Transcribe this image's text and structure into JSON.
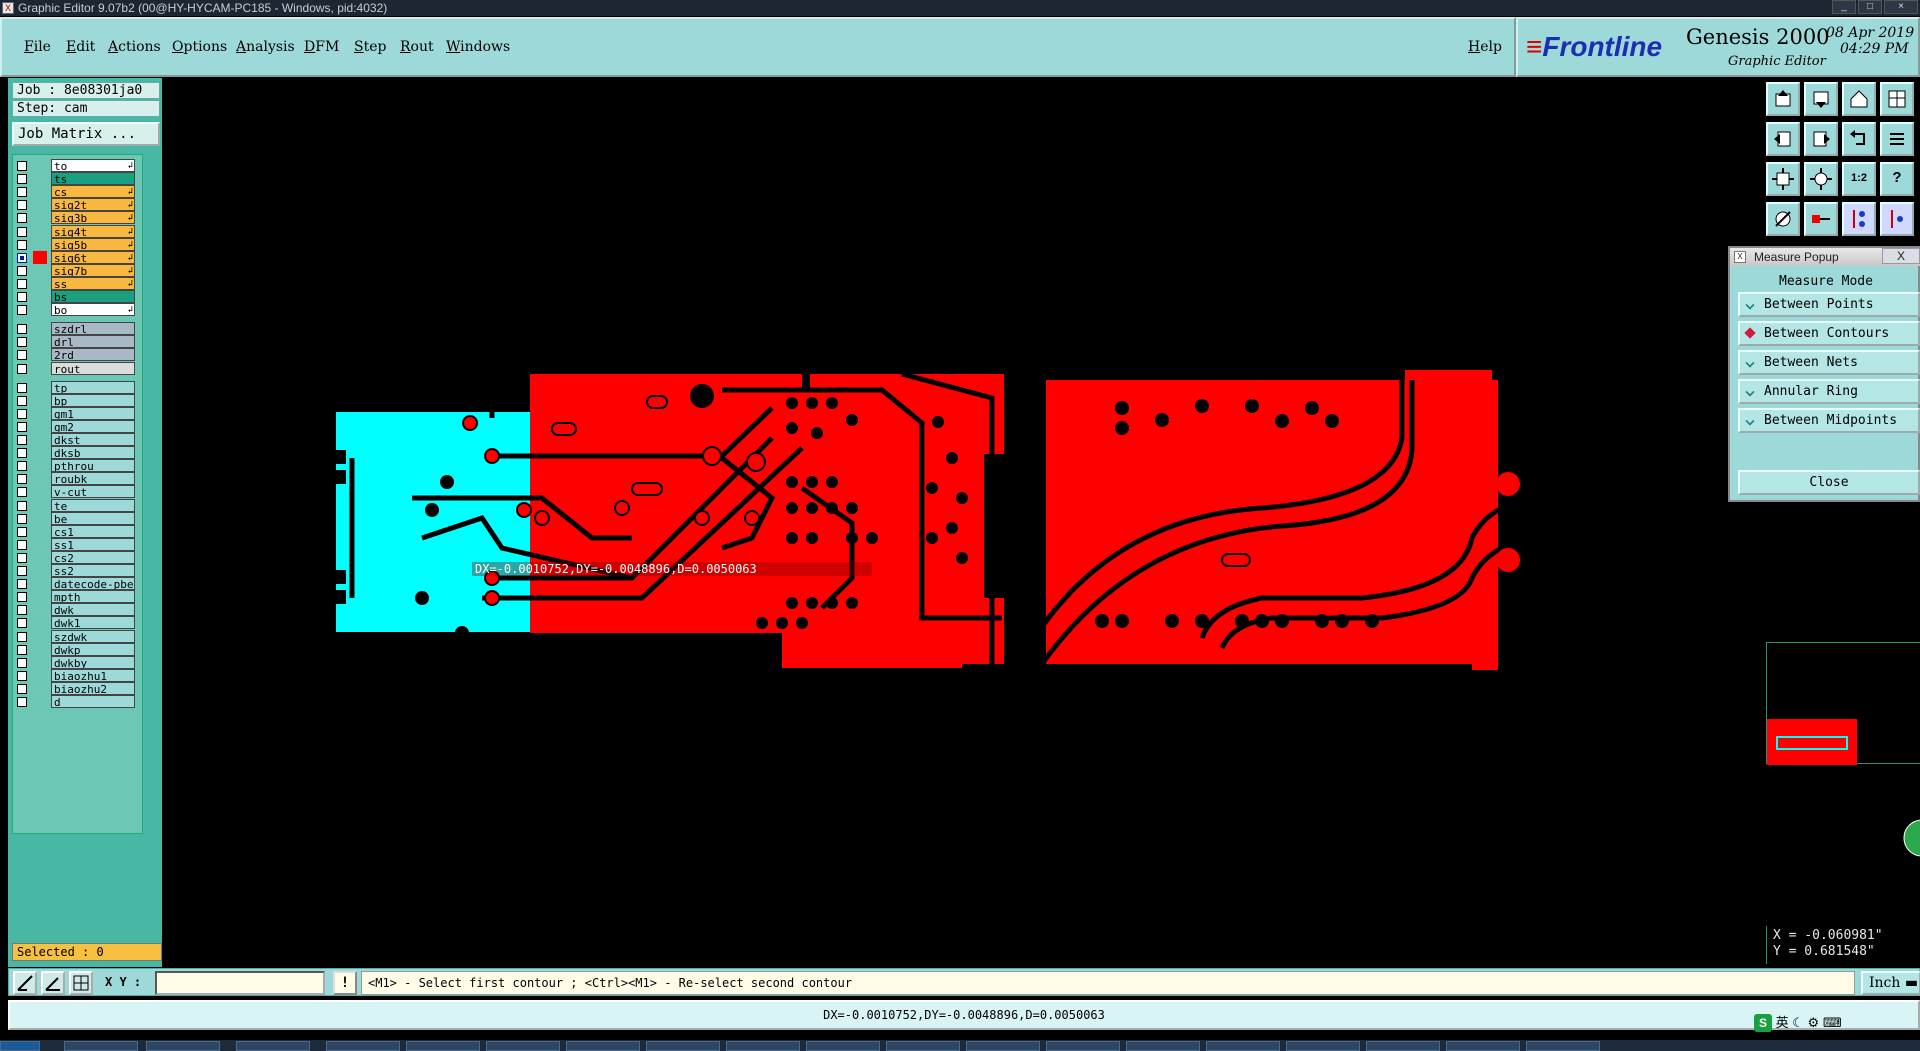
{
  "window": {
    "title": "Graphic Editor 9.07b2 (00@HY-HYCAM-PC185 - Windows, pid:4032)"
  },
  "menu": [
    "File",
    "Edit",
    "Actions",
    "Options",
    "Analysis",
    "DFM",
    "Step",
    "Rout",
    "Windows"
  ],
  "help": "Help",
  "brand": {
    "logo": "Frontline",
    "product": "Genesis 2000",
    "subtitle": "Graphic Editor",
    "date": "08 Apr 2019",
    "time": "04:29 PM"
  },
  "job": {
    "job_label": "Job : 8e08301ja0",
    "step_label": "Step: cam",
    "matrix_button": "Job Matrix ..."
  },
  "layers": [
    {
      "name": "to",
      "color": "#ffffff",
      "arrow": true
    },
    {
      "name": "ts",
      "color": "#1aa080",
      "arrow": false
    },
    {
      "name": "cs",
      "color": "#f8b840",
      "arrow": true
    },
    {
      "name": "sig2t",
      "color": "#f8b840",
      "arrow": true
    },
    {
      "name": "sig3b",
      "color": "#f8b840",
      "arrow": true
    },
    {
      "name": "sig4t",
      "color": "#f8b840",
      "arrow": true
    },
    {
      "name": "sig5b",
      "color": "#f8b840",
      "arrow": true
    },
    {
      "name": "sig6t",
      "color": "#f8b840",
      "arrow": true,
      "active": true
    },
    {
      "name": "sig7b",
      "color": "#f8b840",
      "arrow": true
    },
    {
      "name": "ss",
      "color": "#f8b840",
      "arrow": true
    },
    {
      "name": "bs",
      "color": "#1aa080",
      "arrow": false
    },
    {
      "name": "bo",
      "color": "#ffffff",
      "arrow": true
    },
    {
      "name": "szdrl",
      "color": "#a8b8c4",
      "arrow": false,
      "gap": true
    },
    {
      "name": "drl",
      "color": "#a8b8c4",
      "arrow": false
    },
    {
      "name": "2rd",
      "color": "#a8b8c4",
      "arrow": false
    },
    {
      "name": "rout",
      "color": "#dcdcdc",
      "arrow": false
    },
    {
      "name": "tp",
      "color": "#9ed9d9",
      "arrow": false,
      "gap": true
    },
    {
      "name": "bp",
      "color": "#9ed9d9",
      "arrow": false
    },
    {
      "name": "gm1",
      "color": "#9ed9d9",
      "arrow": false
    },
    {
      "name": "gm2",
      "color": "#9ed9d9",
      "arrow": false
    },
    {
      "name": "dkst",
      "color": "#9ed9d9",
      "arrow": false
    },
    {
      "name": "dksb",
      "color": "#9ed9d9",
      "arrow": false
    },
    {
      "name": "pthrou",
      "color": "#9ed9d9",
      "arrow": false
    },
    {
      "name": "roubk",
      "color": "#9ed9d9",
      "arrow": false
    },
    {
      "name": "v-cut",
      "color": "#9ed9d9",
      "arrow": false
    },
    {
      "name": "te",
      "color": "#9ed9d9",
      "arrow": false
    },
    {
      "name": "be",
      "color": "#9ed9d9",
      "arrow": false
    },
    {
      "name": "cs1",
      "color": "#9ed9d9",
      "arrow": false
    },
    {
      "name": "ss1",
      "color": "#9ed9d9",
      "arrow": false
    },
    {
      "name": "cs2",
      "color": "#9ed9d9",
      "arrow": false
    },
    {
      "name": "ss2",
      "color": "#9ed9d9",
      "arrow": false
    },
    {
      "name": "datecode-pbe",
      "color": "#9ed9d9",
      "arrow": false
    },
    {
      "name": "mpth",
      "color": "#9ed9d9",
      "arrow": false
    },
    {
      "name": "dwk",
      "color": "#9ed9d9",
      "arrow": false
    },
    {
      "name": "dwk1",
      "color": "#9ed9d9",
      "arrow": false
    },
    {
      "name": "szdwk",
      "color": "#9ed9d9",
      "arrow": false
    },
    {
      "name": "dwkp",
      "color": "#9ed9d9",
      "arrow": false
    },
    {
      "name": "dwkby",
      "color": "#9ed9d9",
      "arrow": false
    },
    {
      "name": "biaozhu1",
      "color": "#9ed9d9",
      "arrow": false
    },
    {
      "name": "biaozhu2",
      "color": "#9ed9d9",
      "arrow": false
    },
    {
      "name": "d",
      "color": "#9ed9d9",
      "arrow": false
    }
  ],
  "selected": "Selected : 0",
  "measure": {
    "header": "Measure Popup",
    "header_close": "X",
    "title": "Measure Mode",
    "options": [
      "Between Points",
      "Between Contours",
      "Between Nets",
      "Annular Ring",
      "Between Midpoints"
    ],
    "selected_option": "Between Contours",
    "close": "Close"
  },
  "canvas": {
    "measurement": "DX=-0.0010752,DY=-0.0048896,D=0.0050063"
  },
  "toolbar_labels": {
    "one_to_two": "1:2",
    "question": "?"
  },
  "coords": {
    "x": "X = -0.060981\"",
    "y": "Y = 0.681548\""
  },
  "command": {
    "xy_label": "X Y :",
    "xy_value": "",
    "bang": "!",
    "prompt": "<M1> - Select first contour ; <Ctrl><M1> - Re-select second contour",
    "unit": "Inch"
  },
  "status": "DX=-0.0010752,DY=-0.0048896,D=0.0050063",
  "tray": {
    "ime": "英"
  },
  "colors": {
    "panel": "#9ed9d9",
    "layer_panel": "#48b8a4",
    "copper": "#ff0000",
    "soldermask": "#00ffff"
  }
}
